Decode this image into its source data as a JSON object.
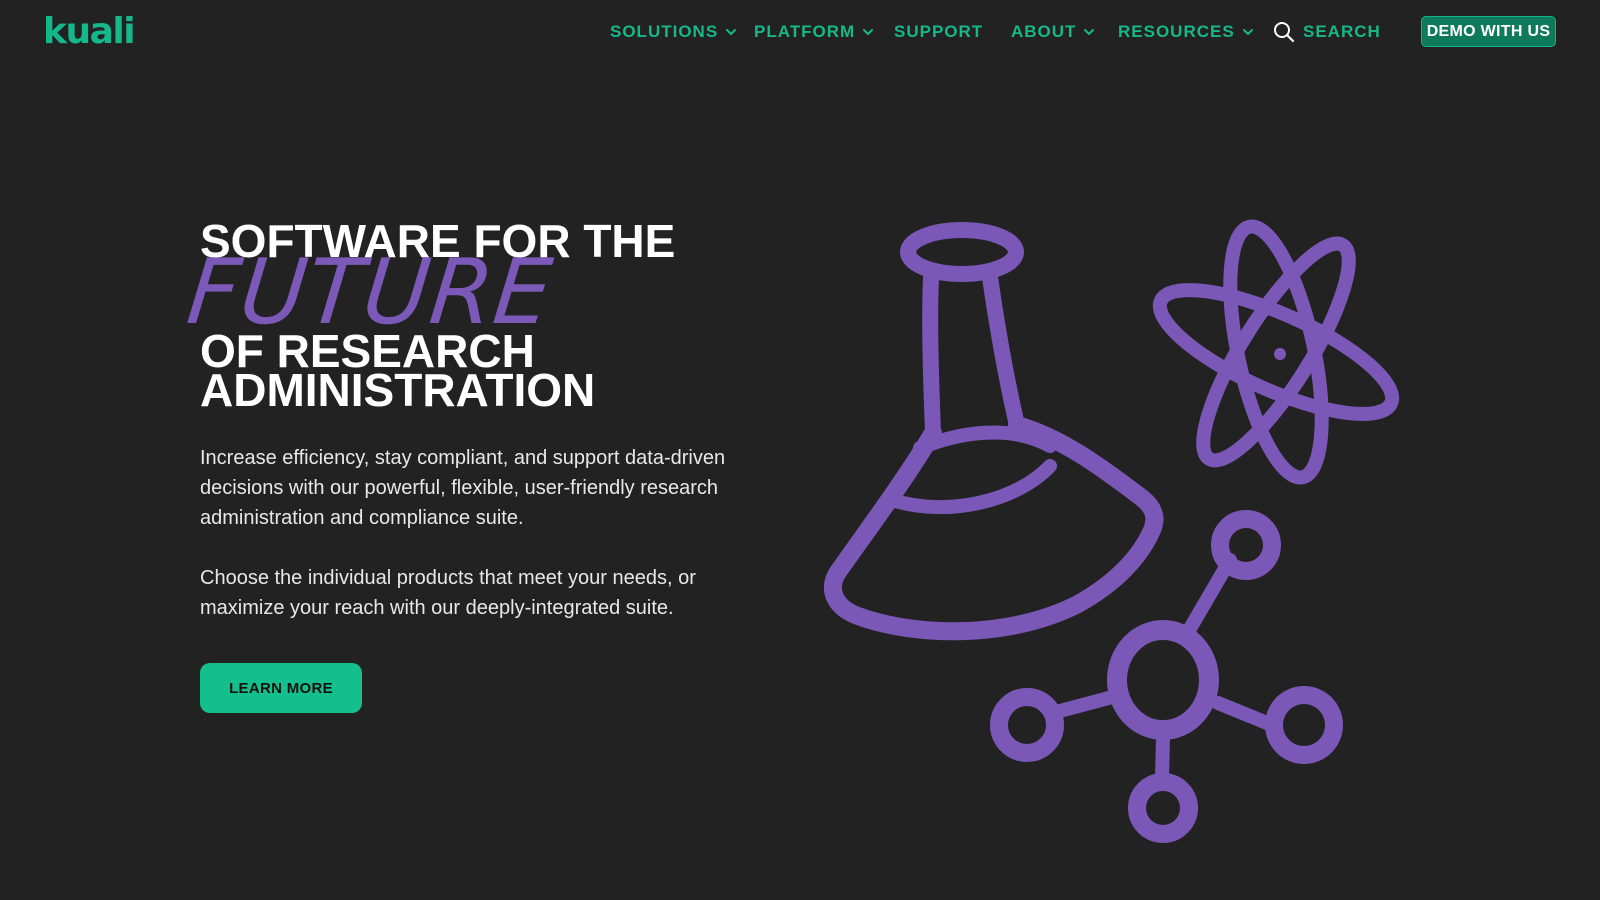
{
  "brand": {
    "logo_text": "kuali",
    "accent_color": "#15b886",
    "illustration_color": "#7b58b8",
    "background_color": "#222222"
  },
  "nav": {
    "items": [
      {
        "label": "SOLUTIONS",
        "dropdown": true
      },
      {
        "label": "PLATFORM",
        "dropdown": true
      },
      {
        "label": "SUPPORT",
        "dropdown": false
      },
      {
        "label": "ABOUT",
        "dropdown": true
      },
      {
        "label": "RESOURCES",
        "dropdown": true
      }
    ],
    "search_label": "SEARCH",
    "demo_label": "DEMO WITH US"
  },
  "hero": {
    "line1": "SOFTWARE FOR THE",
    "script_word": "FUTURE",
    "line2": "OF RESEARCH",
    "line3": "ADMINISTRATION",
    "paragraph1": "Increase efficiency, stay compliant, and support data-driven decisions with our powerful, flexible, user-friendly research administration and compliance suite.",
    "paragraph2": "Choose the individual products that meet your needs, or maximize your reach with our deeply-integrated suite.",
    "cta_label": "LEARN MORE"
  },
  "illustration": {
    "icons": [
      "flask-icon",
      "atom-icon",
      "molecule-icon"
    ]
  }
}
